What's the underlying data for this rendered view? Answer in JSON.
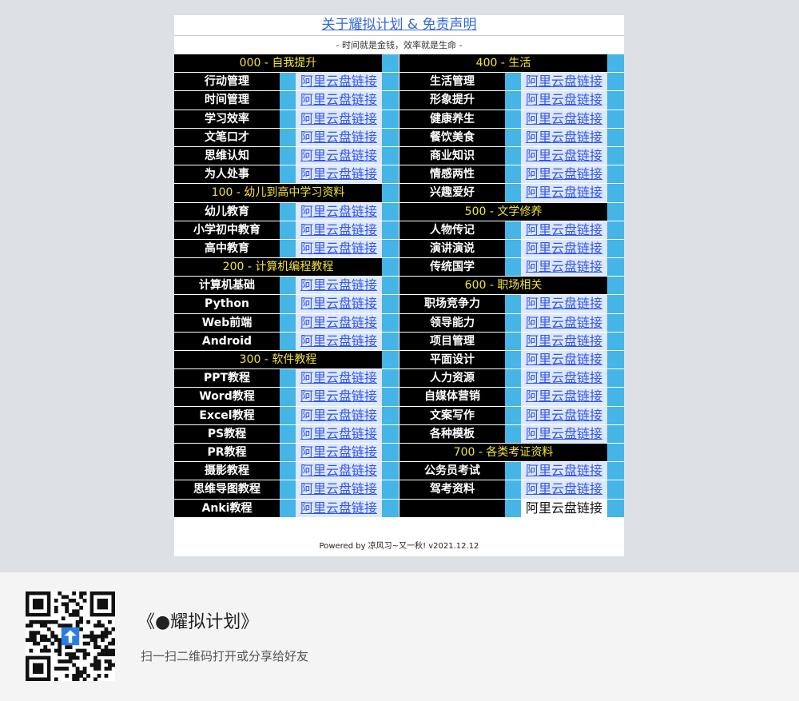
{
  "header": {
    "title": "关于耀拟计划 & 免责声明",
    "subtitle": "- 时间就是金钱，效率就是生命 -"
  },
  "link_text": "阿里云盘链接",
  "left_column": [
    {
      "section": "000 - 自我提升"
    },
    {
      "cat": "行动管理"
    },
    {
      "cat": "时间管理"
    },
    {
      "cat": "学习效率"
    },
    {
      "cat": "文笔口才"
    },
    {
      "cat": "思维认知"
    },
    {
      "cat": "为人处事"
    },
    {
      "section": "100 - 幼儿到高中学习资料"
    },
    {
      "cat": "幼儿教育"
    },
    {
      "cat": "小学初中教育"
    },
    {
      "cat": "高中教育"
    },
    {
      "section": "200 - 计算机编程教程"
    },
    {
      "cat": "计算机基础"
    },
    {
      "cat": "Python"
    },
    {
      "cat": "Web前端"
    },
    {
      "cat": "Android"
    },
    {
      "section": "300 - 软件教程"
    },
    {
      "cat": "PPT教程"
    },
    {
      "cat": "Word教程"
    },
    {
      "cat": "Excel教程"
    },
    {
      "cat": "PS教程"
    },
    {
      "cat": "PR教程"
    },
    {
      "cat": "摄影教程"
    },
    {
      "cat": "思维导图教程"
    },
    {
      "cat": "Anki教程"
    }
  ],
  "right_column": [
    {
      "section": "400 - 生活"
    },
    {
      "cat": "生活管理"
    },
    {
      "cat": "形象提升"
    },
    {
      "cat": "健康养生"
    },
    {
      "cat": "餐饮美食"
    },
    {
      "cat": "商业知识"
    },
    {
      "cat": "情感两性"
    },
    {
      "cat": "兴趣爱好"
    },
    {
      "section": "500 - 文学修养"
    },
    {
      "cat": "人物传记"
    },
    {
      "cat": "演讲演说"
    },
    {
      "cat": "传统国学"
    },
    {
      "section": "600 - 职场相关"
    },
    {
      "cat": "职场竞争力"
    },
    {
      "cat": "领导能力"
    },
    {
      "cat": "项目管理"
    },
    {
      "cat": "平面设计"
    },
    {
      "cat": "人力资源"
    },
    {
      "cat": "自媒体营销"
    },
    {
      "cat": "文案写作"
    },
    {
      "cat": "各种模板"
    },
    {
      "section": "700 - 各类考证资料"
    },
    {
      "cat": "公务员考试"
    },
    {
      "cat": "驾考资料"
    },
    {
      "cat": "",
      "plain": true
    }
  ],
  "footer": "Powered by 凉风习~又一秋! v2021.12.12",
  "share": {
    "title": "《●耀拟计划》",
    "hint": "扫一扫二维码打开或分享给好友",
    "qr_icon": "qr-code-icon"
  },
  "colors": {
    "page_bg": "#dde0e4",
    "section_bg": "#000000",
    "section_text": "#f2e33a",
    "accent_blue": "#45b4e6",
    "link": "#3355ee"
  }
}
